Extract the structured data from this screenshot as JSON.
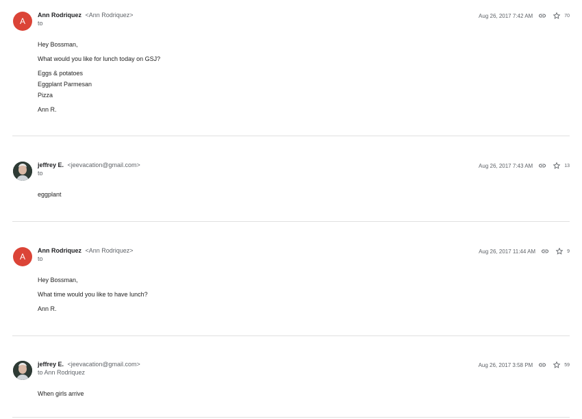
{
  "messages": [
    {
      "sender_name": "Ann Rodriquez",
      "sender_email": "<Ann Rodriquez>",
      "avatar_letter": "A",
      "to": "to",
      "date": "Aug 26, 2017 7:42 AM",
      "count": "70",
      "body_lines": [
        "Hey Bossman,",
        "What would you like for lunch today on GSJ?",
        "Eggs & potatoes",
        "Eggplant Parmesan",
        "Pizza",
        "Ann R."
      ]
    },
    {
      "sender_name": "jeffrey E.",
      "sender_email": "<jeevacation@gmail.com>",
      "to": "to",
      "date": "Aug 26, 2017 7:43 AM",
      "count": "13",
      "body_lines": [
        "eggplant"
      ]
    },
    {
      "sender_name": "Ann Rodriquez",
      "sender_email": "<Ann Rodriquez>",
      "avatar_letter": "A",
      "to": "to",
      "date": "Aug 26, 2017 11:44 AM",
      "count": "9",
      "body_lines": [
        "Hey Bossman,",
        "What time would you like to have lunch?",
        "Ann R."
      ]
    },
    {
      "sender_name": "jeffrey E.",
      "sender_email": "<jeevacation@gmail.com>",
      "to": "to Ann Rodriquez",
      "date": "Aug 26, 2017 3:58 PM",
      "count": "59",
      "body_lines": [
        "When girls arrive"
      ]
    }
  ],
  "icons": {
    "link": "link-icon",
    "star": "star-icon"
  },
  "colors": {
    "avatar_red": "#db4437",
    "divider": "#e0e0e0",
    "meta_text": "#5f6368"
  }
}
